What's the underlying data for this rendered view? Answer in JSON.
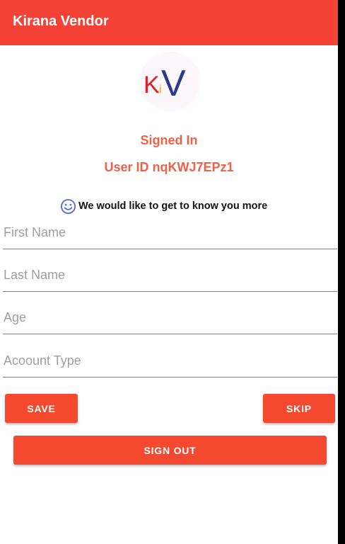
{
  "app": {
    "title": "Kirana Vendor"
  },
  "logo": {
    "letter_k": "K",
    "letter_i": "i",
    "letter_v": "V"
  },
  "status": {
    "signed_in": "Signed In",
    "user_id": "User ID nqKWJ7EPz1"
  },
  "prompt": {
    "icon": "smile-icon",
    "text": "We would like to get to know you more"
  },
  "form": {
    "first_name": {
      "placeholder": "First Name",
      "value": ""
    },
    "last_name": {
      "placeholder": "Last Name",
      "value": ""
    },
    "age": {
      "placeholder": "Age",
      "value": ""
    },
    "account_type": {
      "placeholder": "Acoount Type",
      "value": ""
    }
  },
  "buttons": {
    "save": "SAVE",
    "skip": "SKIP",
    "sign_out": "SIGN OUT"
  },
  "colors": {
    "app_bar": "#f44336",
    "accent_text": "#f06248",
    "button": "#f4492e",
    "logo_v": "#2b3a8f",
    "logo_k": "#e0202a",
    "smile_icon": "#5b6fd9"
  }
}
